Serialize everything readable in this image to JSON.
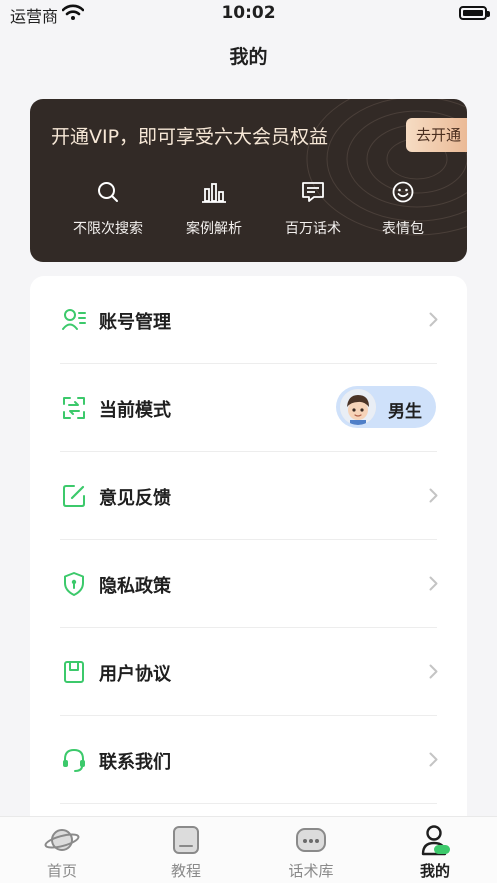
{
  "status_bar": {
    "carrier": "运营商",
    "time": "10:02"
  },
  "page_title": "我的",
  "vip": {
    "title": "开通VIP，即可享受六大会员权益",
    "button": "去开通",
    "features": [
      {
        "label": "不限次搜索",
        "icon": "search-icon"
      },
      {
        "label": "案例解析",
        "icon": "bar-chart-icon"
      },
      {
        "label": "百万话术",
        "icon": "message-icon"
      },
      {
        "label": "表情包",
        "icon": "smile-icon"
      }
    ]
  },
  "menu": {
    "account": "账号管理",
    "mode": "当前模式",
    "mode_value": "男生",
    "feedback": "意见反馈",
    "privacy": "隐私政策",
    "agreement": "用户协议",
    "contact": "联系我们"
  },
  "tabs": [
    {
      "label": "首页",
      "icon": "planet-icon",
      "active": false
    },
    {
      "label": "教程",
      "icon": "tutorial-icon",
      "active": false
    },
    {
      "label": "话术库",
      "icon": "chat-library-icon",
      "active": false
    },
    {
      "label": "我的",
      "icon": "profile-icon",
      "active": true
    }
  ],
  "colors": {
    "accent_green": "#3cc96b",
    "vip_bg": "#322a26",
    "vip_button": "#eab894",
    "chip_bg": "#cfe1fa"
  }
}
